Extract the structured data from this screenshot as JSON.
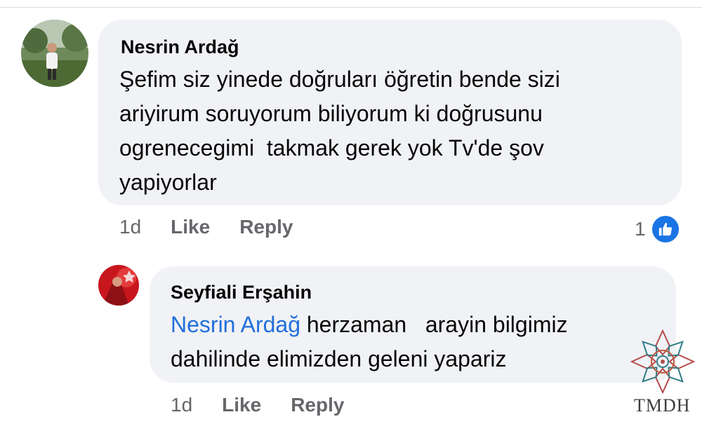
{
  "comments": [
    {
      "author": "Nesrin Ardağ",
      "lines": [
        "Şefim siz yinede doğruları öğretin bende sizi",
        "ariyirum soruyorum biliyorum ki doğrusunu",
        "ogrenecegimi  takmak gerek yok Tv'de şov",
        "yapiyorlar"
      ],
      "time": "1d",
      "like_label": "Like",
      "reply_label": "Reply",
      "reaction_count": "1"
    }
  ],
  "reply": {
    "author": "Seyfiali Erşahin",
    "mention": "Nesrin Ardağ",
    "line1_rest": " herzaman   arayin bilgimiz",
    "line2": "dahilinde elimizden geleni yapariz",
    "time": "1d",
    "like_label": "Like",
    "reply_label": "Reply"
  },
  "watermark": {
    "text": "TMDH"
  },
  "icons": {
    "like_reaction": "thumbs-up-icon",
    "watermark_emblem": "mandala-icon"
  },
  "colors": {
    "bubble": "#f0f2f5",
    "mention": "#216fdb",
    "meta": "#65676b",
    "like_blue": "#1b74e4"
  }
}
